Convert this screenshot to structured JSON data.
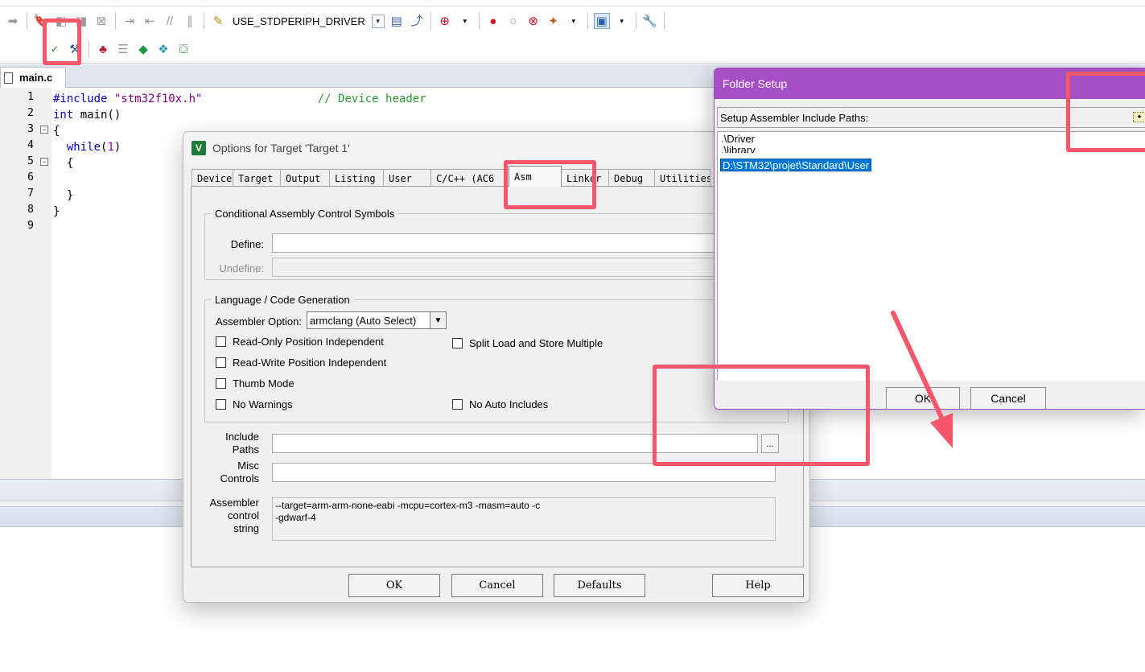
{
  "toolbar": {
    "target_name": "USE_STDPERIPH_DRIVER",
    "icons_row1": [
      "arrow-right-icon",
      "bookmark-icon",
      "bookmark-prev-icon",
      "bookmark-next-icon",
      "bookmark-clear-icon",
      "indent-icon",
      "unindent-icon",
      "comment-icon",
      "uncomment-icon",
      "find-in-files-icon",
      "target-dropdown",
      "inspect-icon",
      "incremental-find-icon",
      "debug-icon",
      "breakpoint-icon",
      "disable-breakpoint-icon",
      "kill-breakpoints-icon",
      "configure-icon",
      "window-layout-icon",
      "tools-icon"
    ],
    "icons_row2": [
      "download-icon",
      "options-for-target-icon",
      "manage-components-icon",
      "select-pack-icon",
      "pack-installer-icon",
      "manage-runtime-icon"
    ]
  },
  "editor": {
    "file_tab": "main.c",
    "line_numbers": [
      "1",
      "2",
      "3",
      "4",
      "5",
      "6",
      "7",
      "8",
      "9"
    ],
    "code": {
      "l1_kw": "#include",
      "l1_str": "\"stm32f10x.h\"",
      "l1_cmt": "// Device header",
      "l2_kw": "int",
      "l2_rest": " main()",
      "l3": "{",
      "l4_kw": "while",
      "l4_open": "(",
      "l4_num": "1",
      "l4_close": ")",
      "l5": "{",
      "l7": "}",
      "l8": "}"
    }
  },
  "options_dialog": {
    "title": "Options for Target 'Target 1'",
    "app_icon_letter": "V",
    "tabs": [
      "Device",
      "Target",
      "Output",
      "Listing",
      "User",
      "C/C++ (AC6",
      "Asm",
      "Linker",
      "Debug",
      "Utilities"
    ],
    "active_tab": "Asm",
    "conditional_group": {
      "legend": "Conditional Assembly Control Symbols",
      "define_label": "Define:",
      "define_value": "",
      "undefine_label": "Undefine:",
      "undefine_value": ""
    },
    "language_group": {
      "legend": "Language / Code Generation",
      "assembler_option_label": "Assembler Option:",
      "assembler_option_value": "armclang (Auto Select)",
      "read_only_pi": "Read-Only Position Independent",
      "read_write_pi": "Read-Write Position Independent",
      "thumb_mode": "Thumb Mode",
      "no_warnings": "No Warnings",
      "split_load_store": "Split Load and Store Multiple",
      "no_auto_includes": "No Auto Includes"
    },
    "include_paths_label_1": "Include",
    "include_paths_label_2": "Paths",
    "include_paths_value": "",
    "browse_label": "...",
    "misc_controls_label_1": "Misc",
    "misc_controls_label_2": "Controls",
    "misc_controls_value": "",
    "control_string_label_1": "Assembler",
    "control_string_label_2": "control",
    "control_string_label_3": "string",
    "control_string_value": "--target=arm-arm-none-eabi -mcpu=cortex-m3 -masm=auto -c\n-gdwarf-4",
    "buttons": {
      "ok": "OK",
      "cancel": "Cancel",
      "defaults": "Defaults",
      "help": "Help"
    }
  },
  "folder_dialog": {
    "title": "Folder Setup",
    "header": "Setup Assembler Include Paths:",
    "paths": [
      ".\\Driver",
      ".\\library",
      "D:\\STM32\\projet\\Standard\\User"
    ],
    "selected_index": 2,
    "buttons": {
      "ok": "OK",
      "cancel": "Cancel"
    }
  },
  "colors": {
    "annotation": "#f5566a",
    "folder_title_bar": "#a64ec4",
    "selection": "#0078d7"
  }
}
